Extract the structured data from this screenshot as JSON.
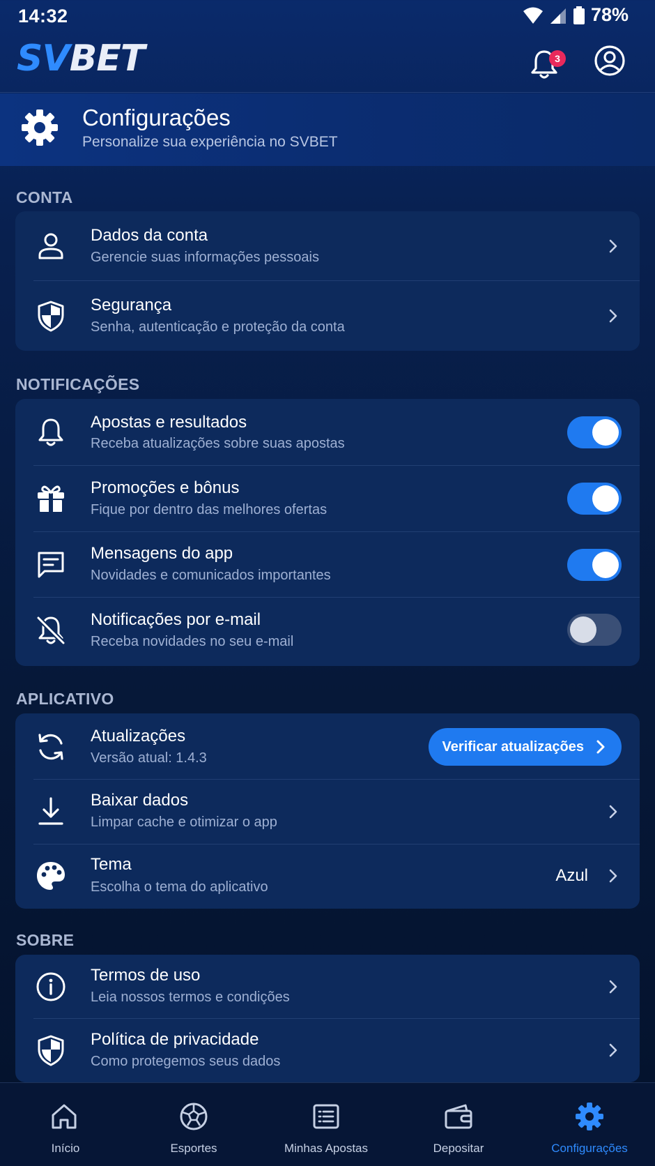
{
  "status_bar": {
    "time": "14:32",
    "battery": "78%"
  },
  "header": {
    "logo_part1": "SV",
    "logo_part2": "BET",
    "notification_count": "3",
    "bell_icon": "bell-icon",
    "account_icon": "account-circle-icon"
  },
  "page": {
    "title": "Configurações",
    "subtitle": "Personalize sua experiência no SVBET",
    "icon": "gear-icon"
  },
  "sections": {
    "conta": {
      "title": "CONTA",
      "items": [
        {
          "title": "Dados da conta",
          "subtitle": "Gerencie suas informações pessoais",
          "icon": "user-icon"
        },
        {
          "title": "Segurança",
          "subtitle": "Senha, autenticação e proteção da conta",
          "icon": "shield-icon"
        }
      ]
    },
    "notificacoes": {
      "title": "NOTIFICAÇÕES",
      "items": [
        {
          "title": "Apostas e resultados",
          "subtitle": "Receba atualizações sobre suas apostas",
          "icon": "bell-icon",
          "enabled": true
        },
        {
          "title": "Promoções e bônus",
          "subtitle": "Fique por dentro das melhores ofertas",
          "icon": "gift-icon",
          "enabled": true
        },
        {
          "title": "Mensagens do app",
          "subtitle": "Novidades e comunicados importantes",
          "icon": "message-icon",
          "enabled": true
        },
        {
          "title": "Notificações por e-mail",
          "subtitle": "Receba novidades no seu e-mail",
          "icon": "bell-off-icon",
          "enabled": false
        }
      ]
    },
    "aplicativo": {
      "title": "APLICATIVO",
      "items": [
        {
          "title": "Atualizações",
          "subtitle": "Versão atual: 1.4.3",
          "icon": "refresh-icon",
          "action_label": "Verificar atualizações"
        },
        {
          "title": "Baixar dados",
          "subtitle": "Limpar cache e otimizar o app",
          "icon": "download-icon"
        },
        {
          "title": "Tema",
          "subtitle": "Escolha o tema do aplicativo",
          "icon": "palette-icon",
          "value": "Azul"
        }
      ]
    },
    "sobre": {
      "title": "SOBRE",
      "items": [
        {
          "title": "Termos de uso",
          "subtitle": "Leia nossos termos e condições",
          "icon": "info-icon"
        },
        {
          "title": "Política de privacidade",
          "subtitle": "Como protegemos seus dados",
          "icon": "shield-icon"
        }
      ]
    }
  },
  "bottom_nav": [
    {
      "label": "Início",
      "icon": "home-icon",
      "active": false
    },
    {
      "label": "Esportes",
      "icon": "soccer-ball-icon",
      "active": false
    },
    {
      "label": "Minhas Apostas",
      "icon": "bet-slip-icon",
      "active": false
    },
    {
      "label": "Depositar",
      "icon": "wallet-icon",
      "active": false
    },
    {
      "label": "Configurações",
      "icon": "gear-icon",
      "active": true
    }
  ],
  "colors": {
    "accent": "#1f7af0",
    "badge": "#e8295c",
    "card": "#0d2a5c",
    "active_nav": "#2f8bff"
  }
}
